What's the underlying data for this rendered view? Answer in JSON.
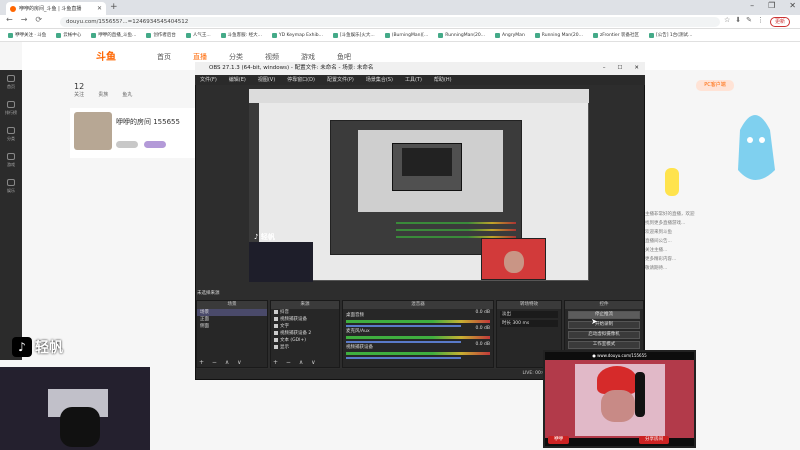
{
  "browser": {
    "tab_title": "咿咿的房间_斗鱼 | 斗鱼直播",
    "new_tab": "+",
    "window_controls": [
      "–",
      "❐",
      "✕"
    ],
    "nav": [
      "←",
      "→",
      "⟳"
    ],
    "url": "douyu.com/155655?...=1246934545404512",
    "profile_label": "更新",
    "ext_icons": [
      "☆",
      "⬇",
      "✎",
      "⋮"
    ],
    "bookmarks": [
      "咿咿关注 · 斗鱼",
      "云帐中心",
      "咿咿的直播_斗鱼...",
      "创作者后台",
      "人气王...",
      "斗鱼客服: 经大...",
      "YD Keymap Exhib...",
      "[斗鱼娱乐]火大...",
      "(BurningMan)[...",
      "RunningMan(20...",
      "AngryMan",
      "Running Man(20...",
      "zFrontier 装备社区",
      "[公告] 1台(测试..."
    ]
  },
  "site": {
    "logo": "斗鱼",
    "nav": [
      "首页",
      "直播",
      "分类",
      "视频",
      "游戏",
      "鱼吧"
    ],
    "active_nav": "直播",
    "sidebar": [
      "首页",
      "排行榜",
      "分类",
      "游戏",
      "娱乐"
    ],
    "stats": [
      {
        "value": "12",
        "label": "关注"
      },
      {
        "value": "",
        "label": "贵族"
      },
      {
        "value": "",
        "label": "鱼丸"
      }
    ],
    "pc_button": "PC客户端",
    "room_name": "咿咿的房间  155655",
    "right_text": [
      "主播非常好的直播，欢迎",
      "找到更多直播游戏...",
      "欢迎来到斗鱼",
      "直播间公告...",
      "关注主播...",
      "更多精彩内容...",
      "敬请期待..."
    ]
  },
  "obs": {
    "title": "OBS 27.1.3 (64-bit, windows) - 配置文件: 未命名 - 场景: 未命名",
    "window_controls": [
      "–",
      "☐",
      "✕"
    ],
    "menu": [
      "文件(F)",
      "编辑(E)",
      "视图(V)",
      "停靠窗口(D)",
      "配置文件(P)",
      "场景集合(S)",
      "工具(T)",
      "帮助(H)"
    ],
    "scene_label": "未选择来源",
    "panels": {
      "scenes": "场景",
      "sources": "来源",
      "mixer": "混音器",
      "transitions": "转场特效",
      "controls": "控件"
    },
    "scenes": [
      "场景",
      "正面",
      "侧面"
    ],
    "sources": [
      "抖音",
      "视频捕获设备",
      "文字",
      "视频捕获设备 2",
      "文本 (GDI+)",
      "显示"
    ],
    "mixer": [
      {
        "name": "桌面音频",
        "db": "0.0 dB"
      },
      {
        "name": "麦克风/Aux",
        "db": "0.0 dB"
      },
      {
        "name": "视频捕获设备",
        "db": "0.0 dB"
      }
    ],
    "transition": {
      "type": "淡出",
      "duration_label": "时长",
      "duration": "300 ms"
    },
    "controls": [
      "停止推流",
      "开始录制",
      "启动虚拟摄像机",
      "工作室模式",
      "设置",
      "退出"
    ],
    "status": "LIVE: 00:00:00   REC: 00:00:00   CPU: 2.4%, 30.00 fps",
    "toolbar": "+ − ∧ ∨"
  },
  "overlays": {
    "tiktok_small": "♪ 轻帆",
    "tiktok_big_icon": "♪",
    "tiktok_big_text": "轻帆",
    "cam_top": "● www.douyu.com/155655",
    "cam_bottom": "咿咿",
    "bottom_tags": [
      "咿咿",
      "分享房间"
    ]
  }
}
